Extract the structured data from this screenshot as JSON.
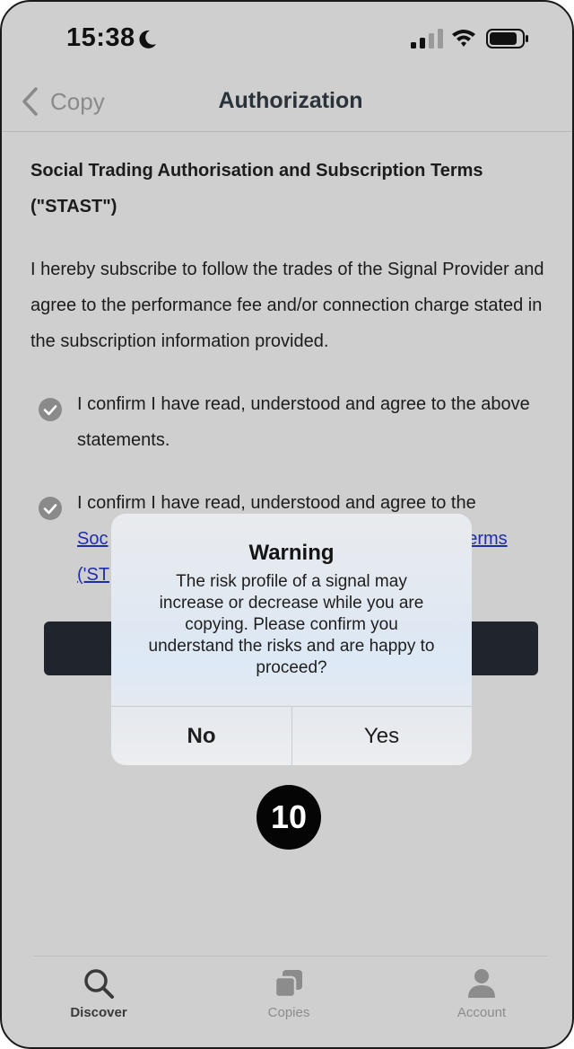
{
  "status_bar": {
    "time": "15:38",
    "moon_icon": "moon-icon",
    "signal_icon": "cellular-signal-icon",
    "wifi_icon": "wifi-icon",
    "battery_icon": "battery-icon"
  },
  "nav": {
    "back_label": "Copy",
    "title": "Authorization"
  },
  "content": {
    "heading": "Social Trading Authorisation and Subscription Terms (\"STAST\")",
    "intro": "I hereby subscribe to follow the trades of the Signal Provider and agree to the performance fee and/or connection charge stated in the subscription information provided.",
    "confirm_1": "I confirm I have read, understood and agree to the above statements.",
    "confirm_2_prefix": "I confirm I have read, understood and agree to the",
    "confirm_2_link_start": "Soc",
    "confirm_2_link_end": "Terms",
    "confirm_2_link_line2": "('ST"
  },
  "alert": {
    "title": "Warning",
    "message": "The risk profile of a signal may\nincrease or decrease while you are\ncopying.  Please confirm you\nunderstand the risks and are happy to\nproceed?",
    "no_label": "No",
    "yes_label": "Yes"
  },
  "step_badge": "10",
  "tabs": [
    {
      "label": "Discover",
      "icon": "search-icon",
      "active": true
    },
    {
      "label": "Copies",
      "icon": "copies-icon",
      "active": false
    },
    {
      "label": "Account",
      "icon": "person-icon",
      "active": false
    }
  ],
  "colors": {
    "overlay_background": "#cfcfcf",
    "link": "#1f2ea8",
    "primary_button": "#20252b",
    "badge": "#050505"
  }
}
